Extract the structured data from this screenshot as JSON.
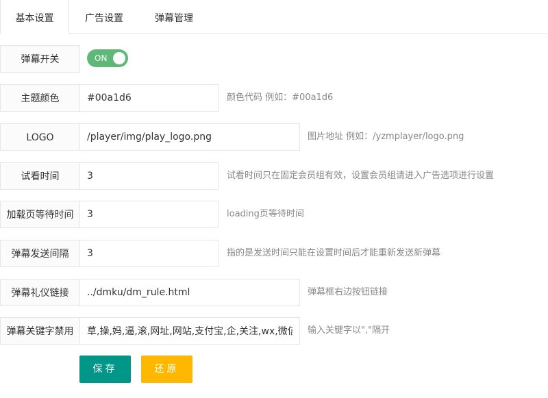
{
  "tabs": [
    {
      "label": "基本设置",
      "active": true
    },
    {
      "label": "广告设置",
      "active": false
    },
    {
      "label": "弹幕管理",
      "active": false
    }
  ],
  "form": {
    "danmu_switch": {
      "label": "弹幕开关",
      "state_text": "ON",
      "on": true
    },
    "theme_color": {
      "label": "主题颜色",
      "value": "#00a1d6",
      "hint": "颜色代码 例如：#00a1d6"
    },
    "logo": {
      "label": "LOGO",
      "value": "/player/img/play_logo.png",
      "hint": "图片地址 例如：/yzmplayer/logo.png"
    },
    "trial_time": {
      "label": "试看时间",
      "value": "3",
      "hint": "试看时间只在固定会员组有效，设置会员组请进入广告选项进行设置"
    },
    "loading_wait": {
      "label": "加载页等待时间",
      "value": "3",
      "hint": "loading页等待时间"
    },
    "send_interval": {
      "label": "弹幕发送间隔",
      "value": "3",
      "hint": "指的是发送时间只能在设置时间后才能重新发送新弹幕"
    },
    "etiquette_link": {
      "label": "弹幕礼仪链接",
      "value": "../dmku/dm_rule.html",
      "hint": "弹幕框右边按钮链接"
    },
    "banned_keywords": {
      "label": "弹幕关键字禁用",
      "value": "草,操,妈,逼,滚,网址,网站,支付宝,企,关注,wx,微信",
      "hint": "输入关键字以\",\"隔开"
    }
  },
  "buttons": {
    "save_label": "保存",
    "reset_label": "还原"
  },
  "colors": {
    "switch_on": "#5fb878",
    "save": "#009688",
    "reset": "#ffb800",
    "theme_value": "#00a1d6"
  }
}
